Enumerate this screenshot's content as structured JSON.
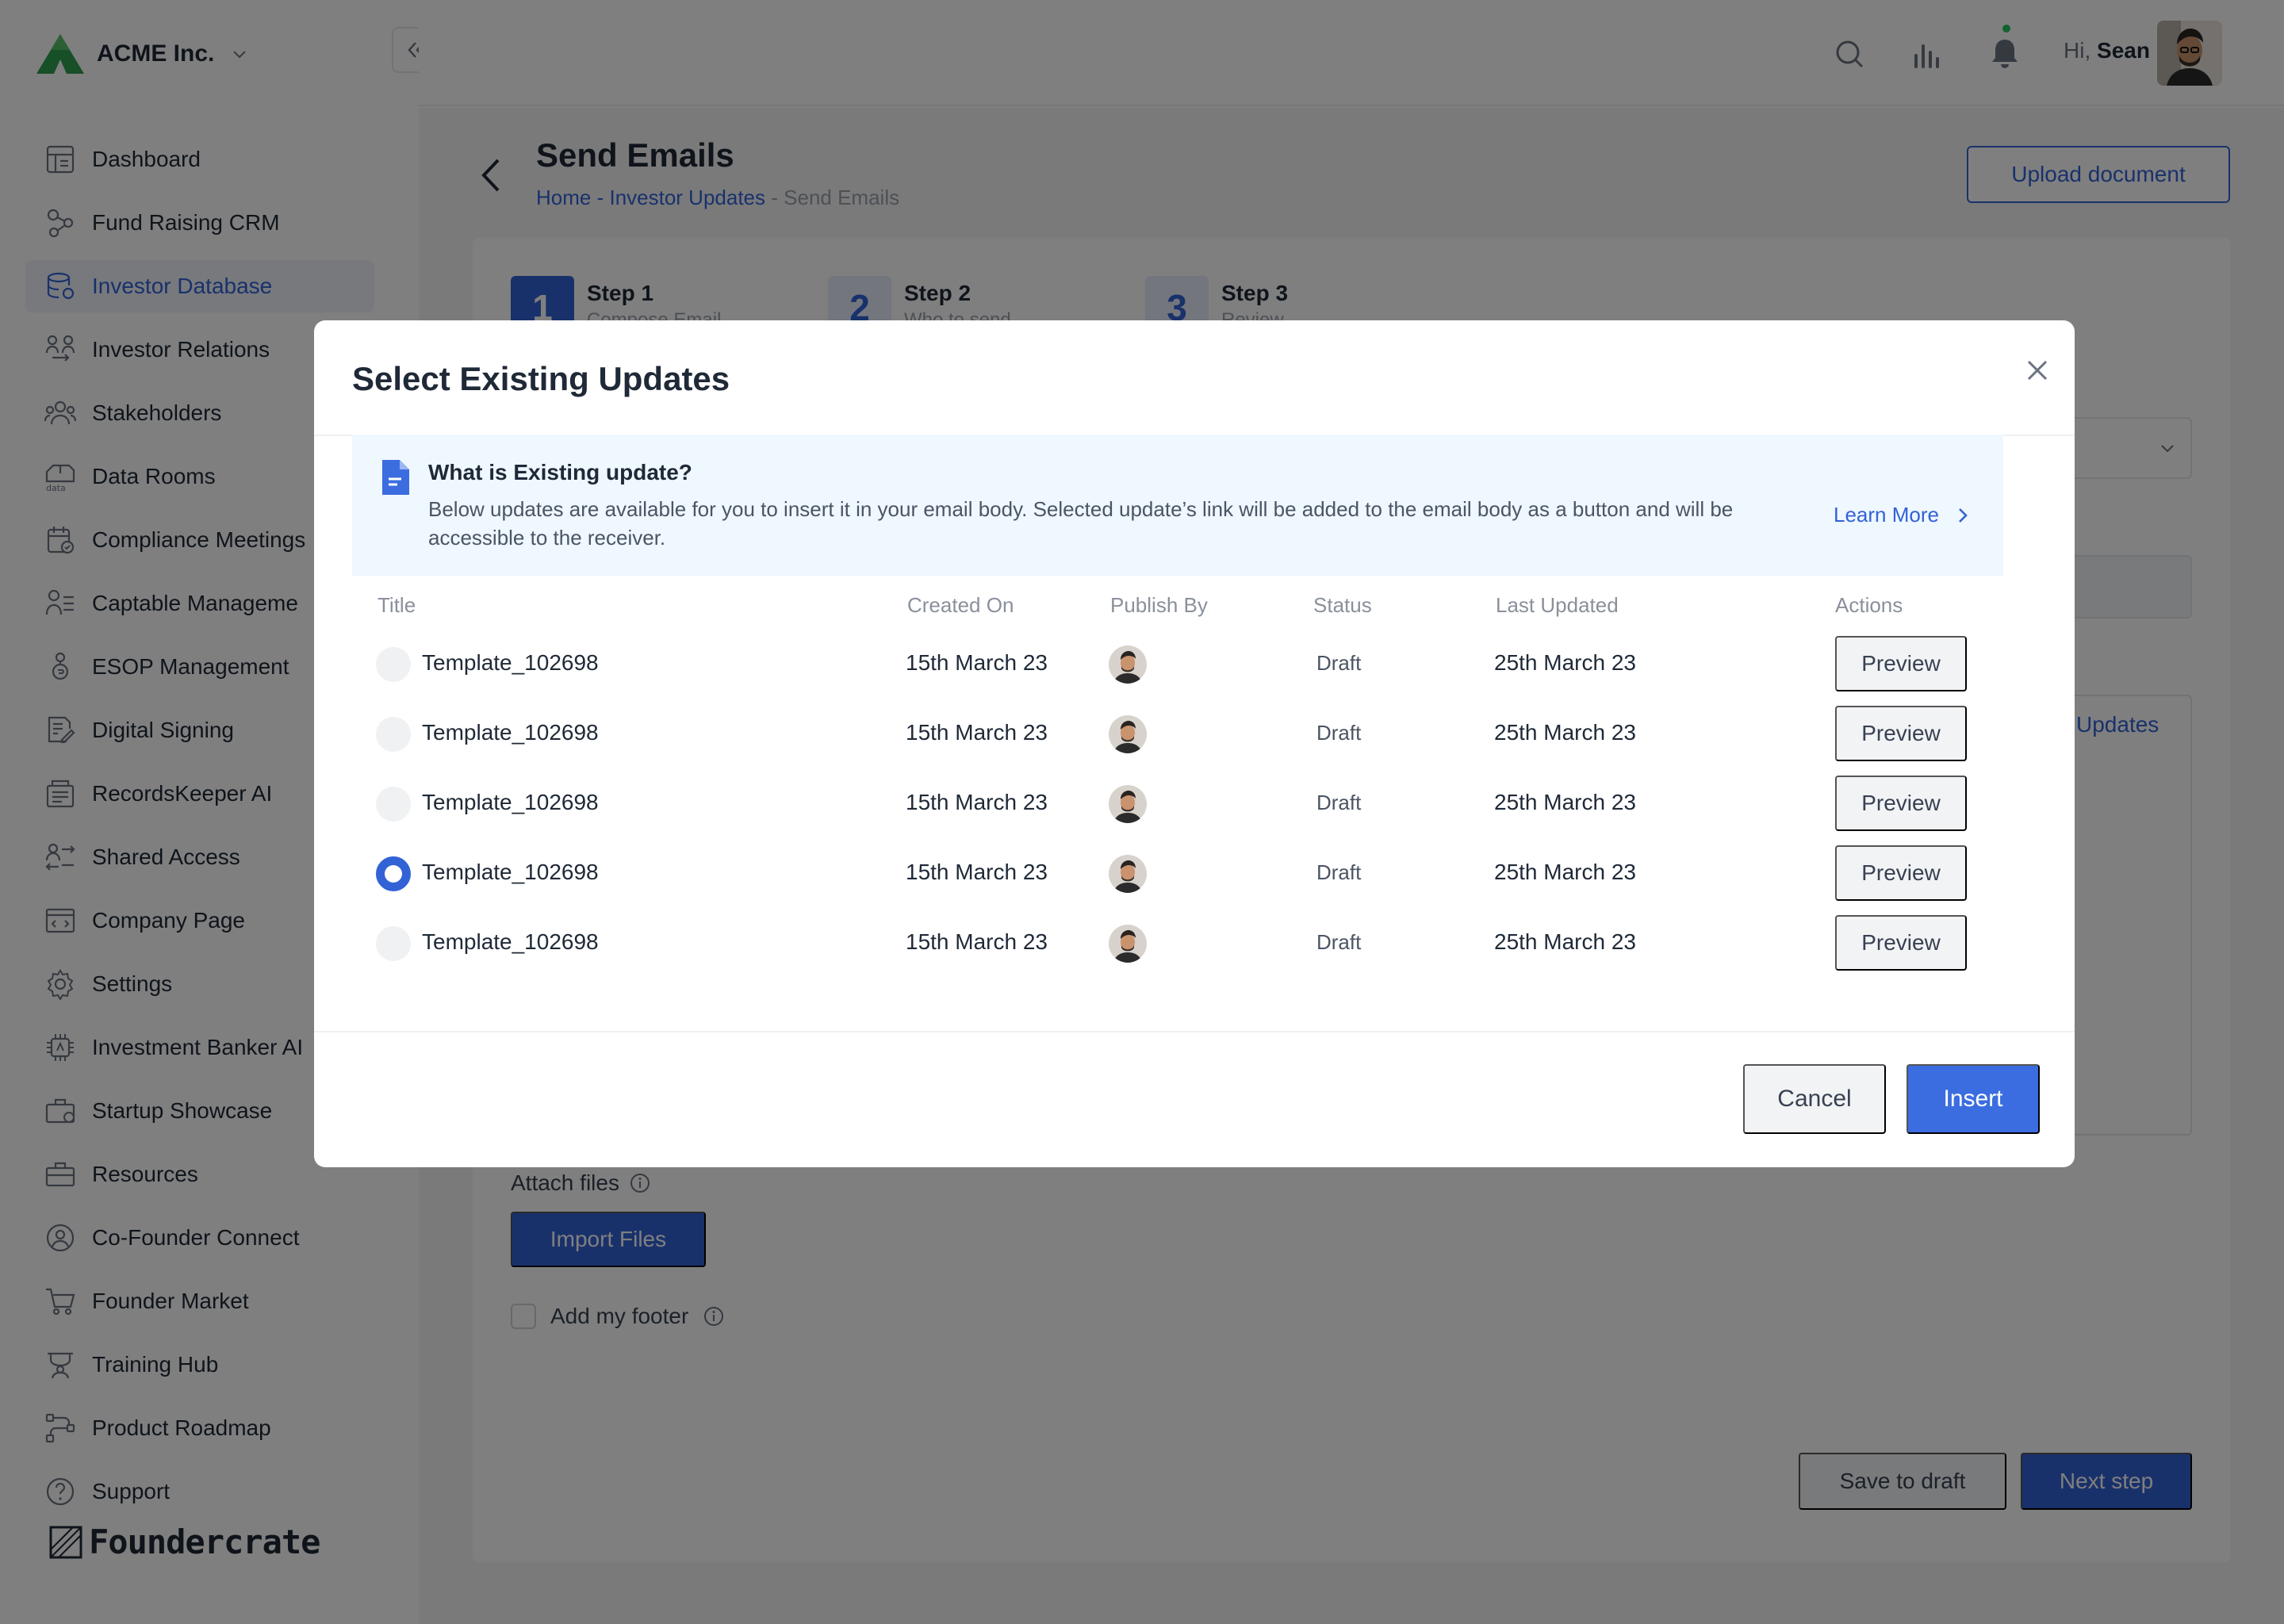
{
  "brand": {
    "name": "ACME Inc."
  },
  "sidebar": {
    "items": [
      {
        "label": "Dashboard",
        "icon": "dashboard-icon",
        "active": false
      },
      {
        "label": "Fund Raising CRM",
        "icon": "crm-icon",
        "active": false
      },
      {
        "label": "Investor Database",
        "icon": "database-icon",
        "active": true
      },
      {
        "label": "Investor Relations",
        "icon": "relations-icon",
        "active": false
      },
      {
        "label": "Stakeholders",
        "icon": "stakeholders-icon",
        "active": false
      },
      {
        "label": "Data Rooms",
        "icon": "data-rooms-icon",
        "active": false
      },
      {
        "label": "Compliance Meetings",
        "icon": "compliance-icon",
        "active": false
      },
      {
        "label": "Captable Manageme",
        "icon": "captable-icon",
        "active": false
      },
      {
        "label": "ESOP Management",
        "icon": "esop-icon",
        "active": false
      },
      {
        "label": "Digital Signing",
        "icon": "signing-icon",
        "active": false
      },
      {
        "label": "RecordsKeeper AI",
        "icon": "records-icon",
        "active": false
      },
      {
        "label": "Shared Access",
        "icon": "shared-access-icon",
        "active": false
      },
      {
        "label": "Company Page",
        "icon": "company-page-icon",
        "active": false
      },
      {
        "label": "Settings",
        "icon": "gear-icon",
        "active": false
      },
      {
        "label": "Investment Banker AI",
        "icon": "banker-ai-icon",
        "active": false
      },
      {
        "label": "Startup Showcase",
        "icon": "showcase-icon",
        "active": false
      },
      {
        "label": "Resources",
        "icon": "resources-icon",
        "active": false
      },
      {
        "label": "Co-Founder Connect",
        "icon": "cofounder-icon",
        "active": false
      },
      {
        "label": "Founder Market",
        "icon": "cart-icon",
        "active": false
      },
      {
        "label": "Training Hub",
        "icon": "training-icon",
        "active": false
      },
      {
        "label": "Product Roadmap",
        "icon": "roadmap-icon",
        "active": false
      },
      {
        "label": "Support",
        "icon": "help-icon",
        "active": false
      }
    ],
    "footer_logo": "Foundercrate"
  },
  "topbar": {
    "greeting": "Hi,",
    "user": "Sean"
  },
  "page": {
    "title": "Send Emails",
    "breadcrumb": {
      "home": "Home",
      "sep1": " - ",
      "parent": "Investor Updates",
      "sep2": " - ",
      "current": "Send Emails"
    },
    "upload_button": "Upload document",
    "steps": [
      {
        "num": "1",
        "title": "Step 1",
        "sub": "Compose Email"
      },
      {
        "num": "2",
        "title": "Step 2",
        "sub": "Who to send"
      },
      {
        "num": "3",
        "title": "Step 3",
        "sub": "Review"
      }
    ],
    "tab_label": "Updates",
    "attach_label": "Attach files",
    "import_button": "Import Files",
    "footer_label": "Add my footer",
    "save_draft_button": "Save to draft",
    "next_button": "Next step"
  },
  "modal": {
    "title": "Select Existing Updates",
    "info": {
      "title": "What is Existing update?",
      "text": "Below updates are available for you to insert it in your email body. Selected update’s link will be added to the email body as a button and will be accessible to the receiver.",
      "learn_more": "Learn More"
    },
    "columns": {
      "title": "Title",
      "created_on": "Created On",
      "publish_by": "Publish By",
      "status": "Status",
      "last_updated": "Last Updated",
      "actions": "Actions"
    },
    "rows": [
      {
        "title": "Template_102698",
        "created_on": "15th March 23",
        "status": "Draft",
        "last_updated": "25th March 23",
        "action": "Preview",
        "selected": false
      },
      {
        "title": "Template_102698",
        "created_on": "15th March 23",
        "status": "Draft",
        "last_updated": "25th March 23",
        "action": "Preview",
        "selected": false
      },
      {
        "title": "Template_102698",
        "created_on": "15th March 23",
        "status": "Draft",
        "last_updated": "25th March 23",
        "action": "Preview",
        "selected": false
      },
      {
        "title": "Template_102698",
        "created_on": "15th March 23",
        "status": "Draft",
        "last_updated": "25th March 23",
        "action": "Preview",
        "selected": true
      },
      {
        "title": "Template_102698",
        "created_on": "15th March 23",
        "status": "Draft",
        "last_updated": "25th March 23",
        "action": "Preview",
        "selected": false
      }
    ],
    "cancel_button": "Cancel",
    "insert_button": "Insert"
  },
  "colors": {
    "accent": "#3262d6",
    "insert": "#3b6de0",
    "info_bg": "#eff7ff",
    "notification_dot": "#22c55e",
    "logo_green": "#2e9e4f"
  }
}
